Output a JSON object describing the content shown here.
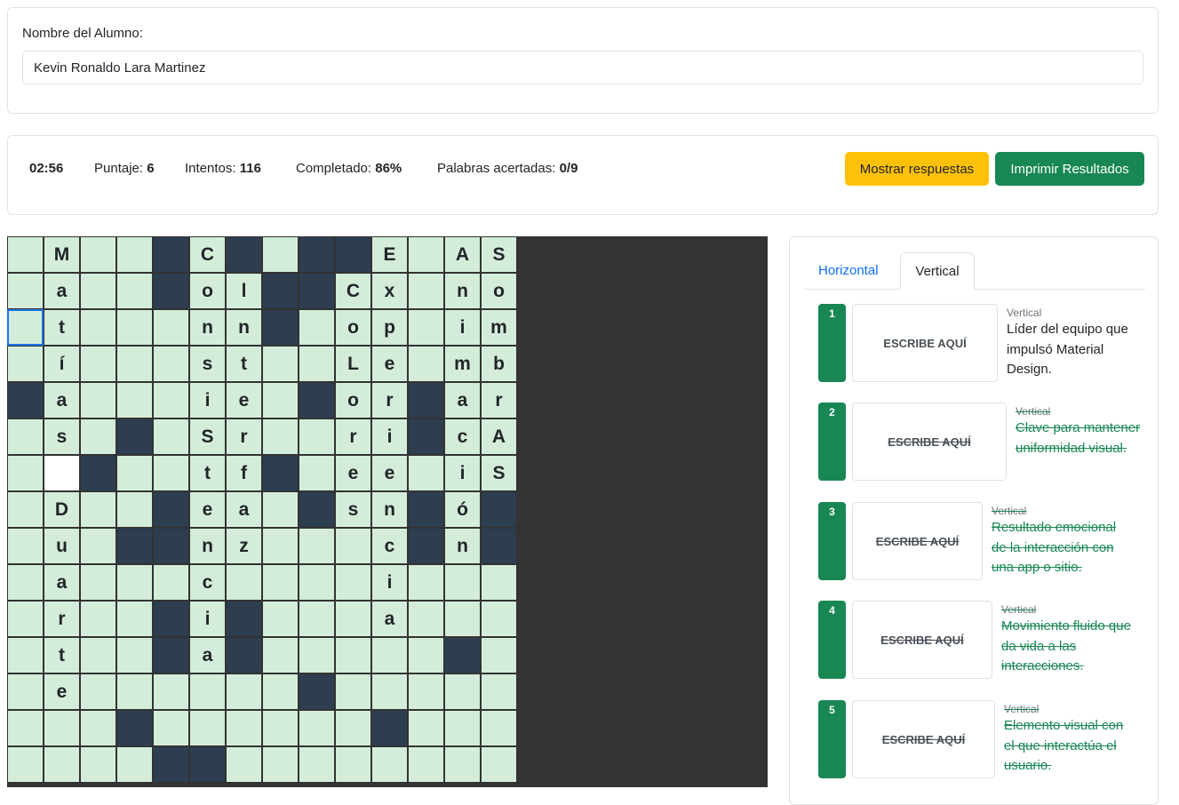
{
  "student": {
    "label": "Nombre del Alumno:",
    "name": "Kevin Ronaldo Lara Martinez"
  },
  "stats": {
    "time": "02:56",
    "score_label": "Puntaje:",
    "score": "6",
    "attempts_label": "Intentos:",
    "attempts": "116",
    "completed_label": "Completado:",
    "completed": "86%",
    "words_label": "Palabras acertadas:",
    "words": "0/9",
    "show_answers": "Mostrar respuestas",
    "print_results": "Imprimir Resultados"
  },
  "colors": {
    "cell": "#d4edda",
    "block": "#2c3e50",
    "accent_green": "#198754",
    "accent_yellow": "#ffc107",
    "tab_link": "#0d6efd"
  },
  "grid": {
    "rows": [
      ".M..#C#.##E.AS",
      ".a..#ol##Cx.no",
      ".t...nn#.op.im",
      ".í...st..Le.mb",
      "#a...ie.#or#ar",
      ".s.#.Sr..ri#cA",
      ".+#..tf#.ee.iS",
      ".D..#ea.#sn#ó#",
      ".u.##nz...c#n#",
      ".a...c....i...",
      ".r..#i#...a...",
      ".t..#a#.....#.",
      ".e......#.....",
      "...#......#...",
      "....##........"
    ],
    "focus": [
      2,
      0
    ]
  },
  "tabs": {
    "horizontal": "Horizontal",
    "vertical": "Vertical"
  },
  "clues": [
    {
      "num": "1",
      "placeholder": "ESCRIBE AQUÍ",
      "dir": "Vertical",
      "text": "Líder del equipo que impulsó Material Design.",
      "solved": false
    },
    {
      "num": "2",
      "placeholder": "ESCRIBE AQUÍ",
      "dir": "Vertical",
      "text": "Clave para mantener uniformidad visual.",
      "solved": true
    },
    {
      "num": "3",
      "placeholder": "ESCRIBE AQUÍ",
      "dir": "Vertical",
      "text": "Resultado emocional de la interacción con una app o sitio.",
      "solved": true
    },
    {
      "num": "4",
      "placeholder": "ESCRIBE AQUÍ",
      "dir": "Vertical",
      "text": "Movimiento fluido que da vida a las interacciones.",
      "solved": true
    },
    {
      "num": "5",
      "placeholder": "ESCRIBE AQUÍ",
      "dir": "Vertical",
      "text": "Elemento visual con el que interactúa el usuario.",
      "solved": true
    }
  ]
}
